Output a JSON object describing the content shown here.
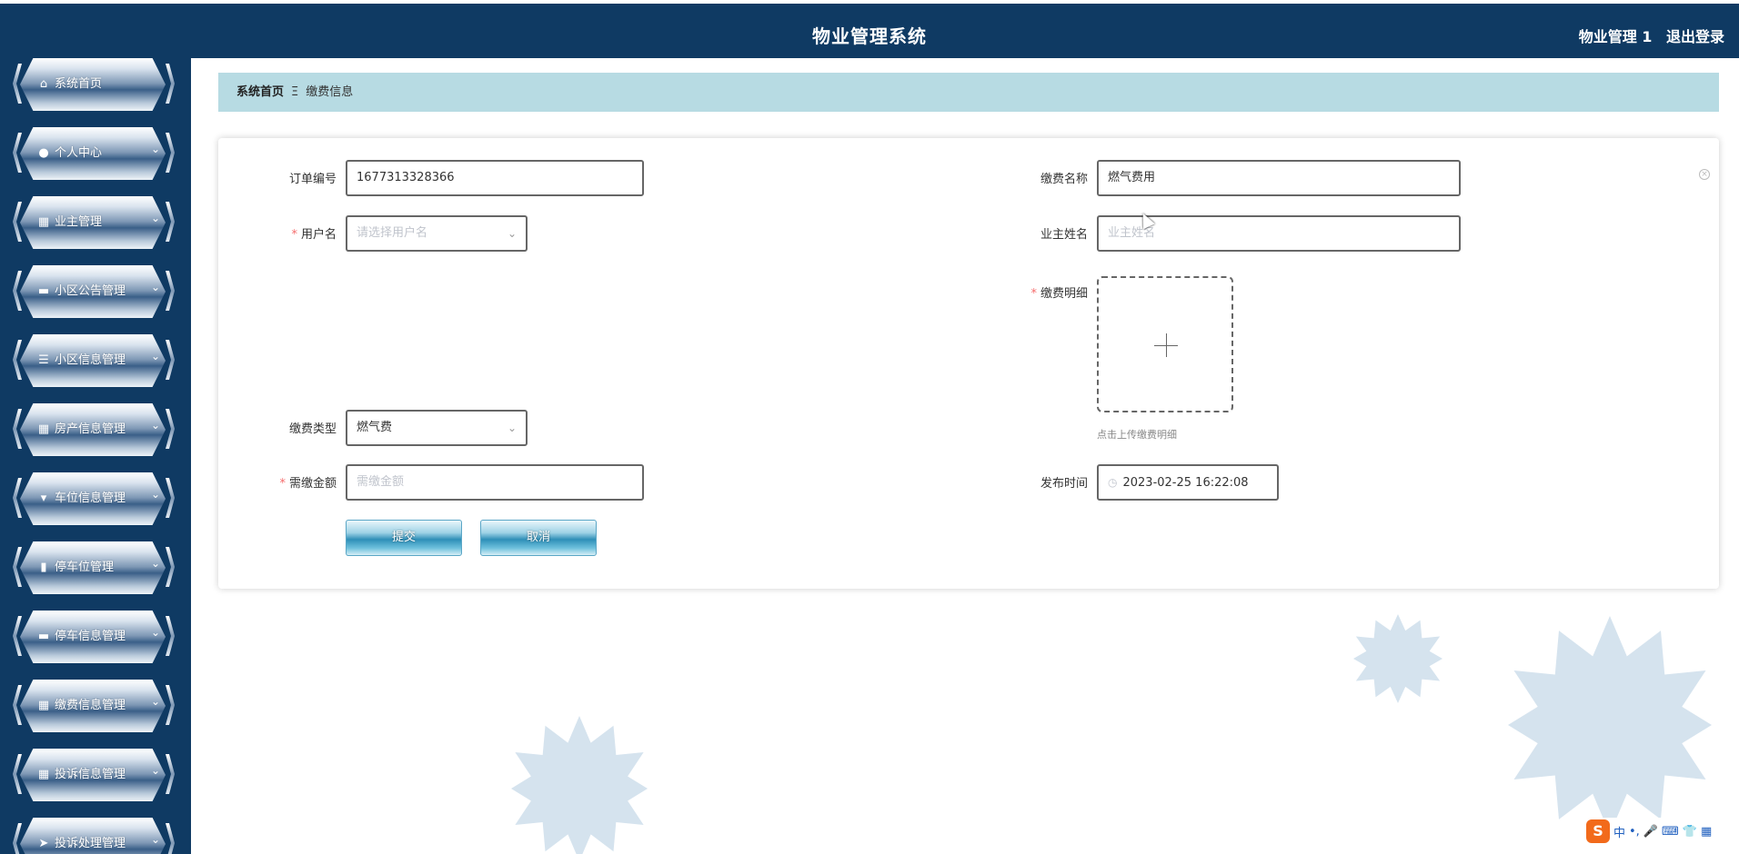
{
  "header": {
    "title": "物业管理系统",
    "user_name": "物业管理 1",
    "logout_label": "退出登录"
  },
  "sidebar": {
    "items": [
      {
        "label": "系统首页",
        "icon": "home-icon",
        "glyph": "⌂",
        "has_arrow": false
      },
      {
        "label": "个人中心",
        "icon": "user-icon",
        "glyph": "●",
        "has_arrow": true
      },
      {
        "label": "业主管理",
        "icon": "grid-icon",
        "glyph": "▦",
        "has_arrow": true
      },
      {
        "label": "小区公告管理",
        "icon": "monitor-icon",
        "glyph": "▬",
        "has_arrow": true
      },
      {
        "label": "小区信息管理",
        "icon": "list-icon",
        "glyph": "☰",
        "has_arrow": true
      },
      {
        "label": "房产信息管理",
        "icon": "grid-icon",
        "glyph": "▦",
        "has_arrow": true
      },
      {
        "label": "车位信息管理",
        "icon": "sign-icon",
        "glyph": "▾",
        "has_arrow": true
      },
      {
        "label": "停车位管理",
        "icon": "bar-chart-icon",
        "glyph": "▮",
        "has_arrow": true
      },
      {
        "label": "停车信息管理",
        "icon": "ticket-icon",
        "glyph": "▬",
        "has_arrow": true
      },
      {
        "label": "缴费信息管理",
        "icon": "grid-icon",
        "glyph": "▦",
        "has_arrow": true
      },
      {
        "label": "投诉信息管理",
        "icon": "grid-icon",
        "glyph": "▦",
        "has_arrow": true
      },
      {
        "label": "投诉处理管理",
        "icon": "send-icon",
        "glyph": "➤",
        "has_arrow": true
      }
    ],
    "arrow_glyph": "⌄"
  },
  "breadcrumb": {
    "home": "系统首页",
    "separator": "Ξ",
    "current": "缴费信息"
  },
  "form": {
    "order_no": {
      "label": "订单编号",
      "value": "1677313328366"
    },
    "fee_name": {
      "label": "缴费名称",
      "value": "燃气费用"
    },
    "username": {
      "label": "用户名",
      "placeholder": "请选择用户名",
      "required": true
    },
    "owner_name": {
      "label": "业主姓名",
      "placeholder": "业主姓名"
    },
    "fee_detail": {
      "label": "缴费明细",
      "required": true,
      "hint": "点击上传缴费明细"
    },
    "fee_type": {
      "label": "缴费类型",
      "value": "燃气费"
    },
    "amount_due": {
      "label": "需缴金额",
      "placeholder": "需缴金额",
      "required": true
    },
    "publish_time": {
      "label": "发布时间",
      "value": "2023-02-25 16:22:08"
    },
    "submit_label": "提交",
    "cancel_label": "取消",
    "required_mark": "*",
    "close_glyph": "×"
  },
  "ime_toolbar": {
    "logo": "S",
    "lang": "中",
    "punct": "•,",
    "mic": "🎤",
    "keyboard": "⌨",
    "skin": "👕",
    "grid": "▦"
  },
  "colors": {
    "header_bg": "#0f3a63",
    "breadcrumb_bg": "#b7dbe3",
    "star": "#d5e3ee",
    "required": "#f56c6c"
  }
}
